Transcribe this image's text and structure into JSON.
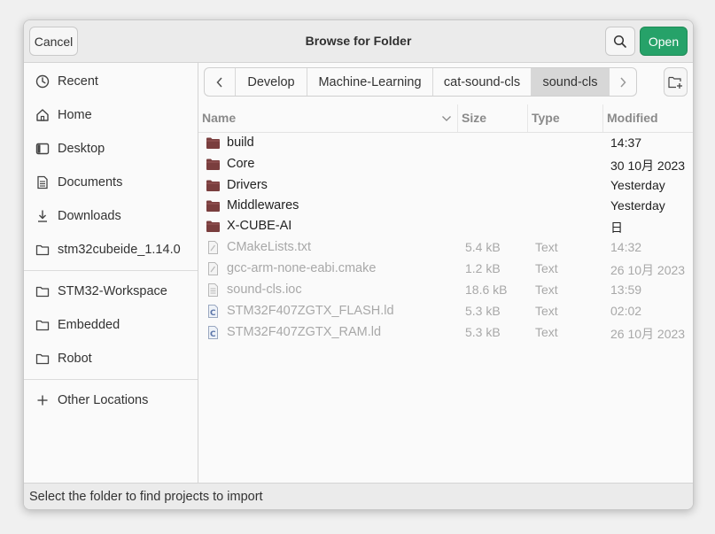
{
  "dialog": {
    "title": "Browse for Folder",
    "cancel_label": "Cancel",
    "open_label": "Open",
    "status": "Select the folder to find projects to import"
  },
  "sidebar": {
    "items": [
      {
        "label": "Recent",
        "icon": "clock-icon"
      },
      {
        "label": "Home",
        "icon": "home-icon"
      },
      {
        "label": "Desktop",
        "icon": "desktop-icon"
      },
      {
        "label": "Documents",
        "icon": "document-icon"
      },
      {
        "label": "Downloads",
        "icon": "download-icon"
      },
      {
        "label": "stm32cubeide_1.14.0",
        "icon": "folder-icon"
      }
    ],
    "bookmarks": [
      {
        "label": "STM32-Workspace",
        "icon": "folder-icon"
      },
      {
        "label": "Embedded",
        "icon": "folder-icon"
      },
      {
        "label": "Robot",
        "icon": "folder-icon"
      }
    ],
    "other": {
      "label": "Other Locations",
      "icon": "plus-icon"
    }
  },
  "pathbar": {
    "crumbs": [
      "Develop",
      "Machine-Learning",
      "cat-sound-cls",
      "sound-cls"
    ],
    "active": "sound-cls"
  },
  "columns": {
    "name": "Name",
    "size": "Size",
    "type": "Type",
    "modified": "Modified"
  },
  "files": [
    {
      "name": "build",
      "size": "",
      "type": "",
      "modified": "14:37",
      "kind": "folder"
    },
    {
      "name": "Core",
      "size": "",
      "type": "",
      "modified": "30 10月 2023",
      "kind": "folder"
    },
    {
      "name": "Drivers",
      "size": "",
      "type": "",
      "modified": "Yesterday",
      "kind": "folder"
    },
    {
      "name": "Middlewares",
      "size": "",
      "type": "",
      "modified": "Yesterday",
      "kind": "folder"
    },
    {
      "name": "X-CUBE-AI",
      "size": "",
      "type": "",
      "modified": "日",
      "kind": "folder"
    },
    {
      "name": "CMakeLists.txt",
      "size": "5.4 kB",
      "type": "Text",
      "modified": "14:32",
      "kind": "script"
    },
    {
      "name": "gcc-arm-none-eabi.cmake",
      "size": "1.2 kB",
      "type": "Text",
      "modified": "26 10月 2023",
      "kind": "script"
    },
    {
      "name": "sound-cls.ioc",
      "size": "18.6 kB",
      "type": "Text",
      "modified": "13:59",
      "kind": "text"
    },
    {
      "name": "STM32F407ZGTX_FLASH.ld",
      "size": "5.3 kB",
      "type": "Text",
      "modified": "02:02",
      "kind": "c-source"
    },
    {
      "name": "STM32F407ZGTX_RAM.ld",
      "size": "5.3 kB",
      "type": "Text",
      "modified": "26 10月 2023",
      "kind": "c-source"
    }
  ],
  "colors": {
    "accent": "#26a269",
    "folder": "#7a3e3e",
    "active_crumb": "#d7d7d7"
  }
}
